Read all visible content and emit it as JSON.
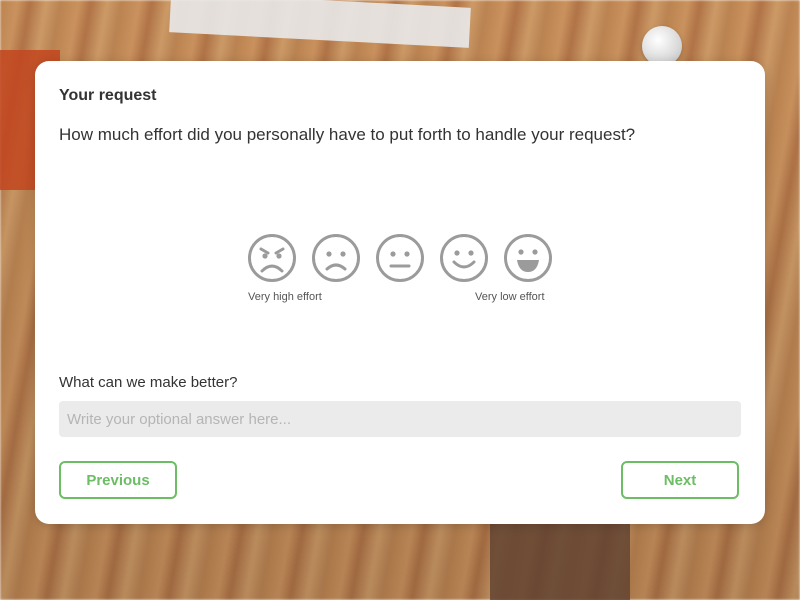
{
  "card": {
    "title": "Your request",
    "question": "How much effort did you personally have to put forth to handle your request?"
  },
  "rating": {
    "faces": [
      {
        "name": "very-high-effort-face-icon"
      },
      {
        "name": "high-effort-face-icon"
      },
      {
        "name": "neutral-face-icon"
      },
      {
        "name": "low-effort-face-icon"
      },
      {
        "name": "very-low-effort-face-icon"
      }
    ],
    "scale_low_label": "Very high effort",
    "scale_high_label": "Very low effort",
    "icon_color": "#9b9b9b"
  },
  "feedback": {
    "label": "What can we make better?",
    "placeholder": "Write your optional answer here...",
    "value": ""
  },
  "buttons": {
    "previous_label": "Previous",
    "next_label": "Next",
    "accent_color": "#6dbd65"
  }
}
